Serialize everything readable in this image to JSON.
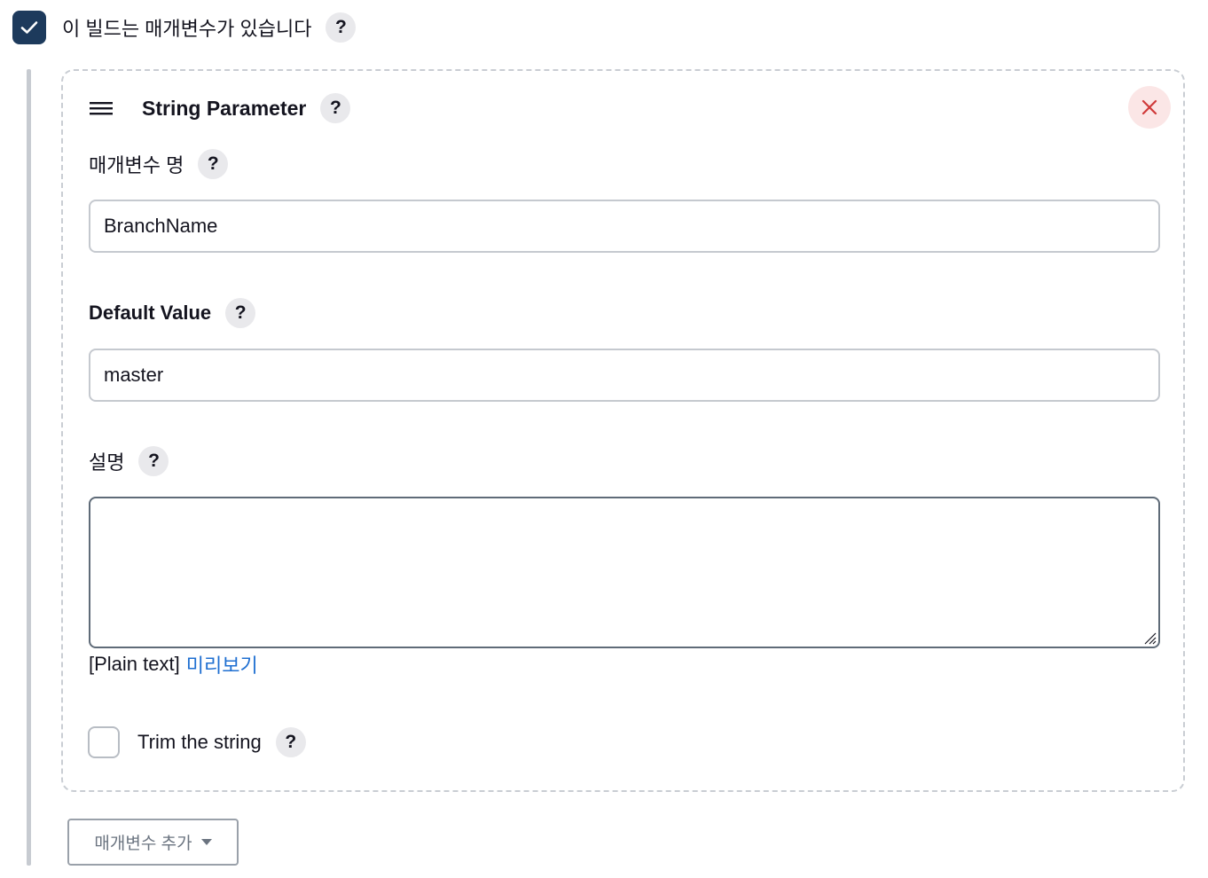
{
  "parameterized": {
    "checked": true,
    "label": "이 빌드는 매개변수가 있습니다",
    "help": "?"
  },
  "parameter": {
    "type_title": "String Parameter",
    "help": "?",
    "fields": {
      "name": {
        "label": "매개변수 명",
        "help": "?",
        "value": "BranchName"
      },
      "default_value": {
        "label": "Default Value",
        "help": "?",
        "value": "master"
      },
      "description": {
        "label": "설명",
        "help": "?",
        "value": ""
      }
    },
    "markup": {
      "format": "[Plain text]",
      "preview_link": "미리보기"
    },
    "trim": {
      "label": "Trim the string",
      "help": "?",
      "checked": false
    }
  },
  "add_parameter_button": {
    "label": "매개변수 추가"
  },
  "colors": {
    "checkbox_checked": "#1d3a5c",
    "close_bg": "#fbe6e6",
    "close_icon": "#d03a3a",
    "link": "#1f6fd1"
  }
}
